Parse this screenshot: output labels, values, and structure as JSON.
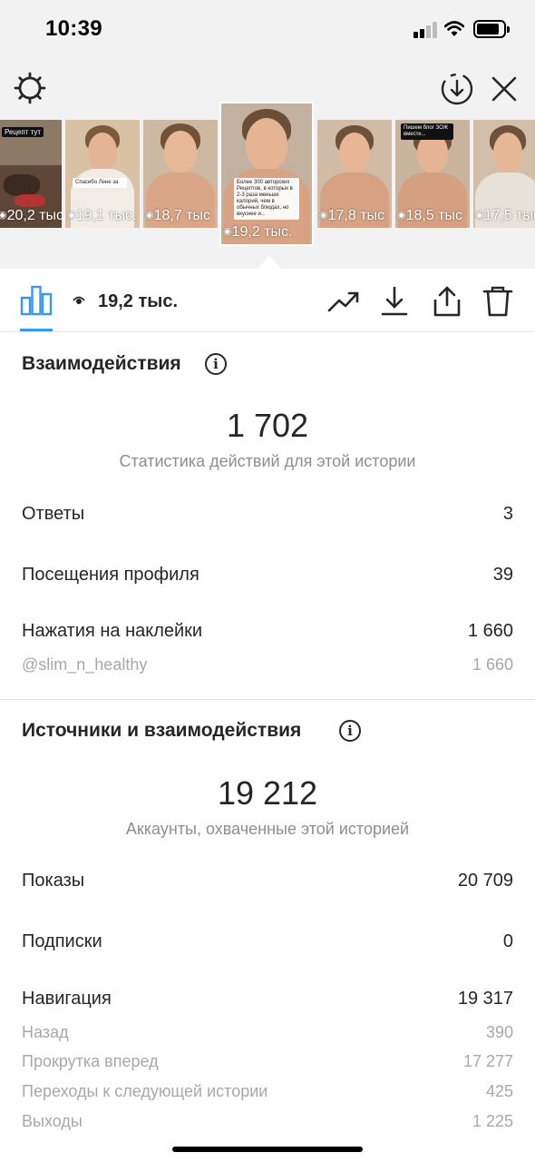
{
  "status_bar": {
    "time": "10:39"
  },
  "thumbnails": [
    {
      "views": "20,2 тыс",
      "tag": "Рецепт тут",
      "active": false
    },
    {
      "views": "19,1 тыс.",
      "tag": "Спасибо Лене за",
      "active": false
    },
    {
      "views": "18,7 тыс",
      "tag": "",
      "active": false
    },
    {
      "views": "19,2 тыс.",
      "tag": "Более 300 авторских Рецептов, в которых в 2-3 раза меньше калорий, чем в обычных блюдах, но вкуснее и...",
      "active": true
    },
    {
      "views": "17,8 тыс",
      "tag": "",
      "active": false
    },
    {
      "views": "18,5 тыс",
      "tag": "Пишем блог ЗОЖ вместе...",
      "active": false
    },
    {
      "views": "17,5 тыс",
      "tag": "",
      "active": false
    }
  ],
  "toolbar": {
    "views": "19,2 тыс."
  },
  "interactions": {
    "title": "Взаимодействия",
    "total": "1 702",
    "subtitle": "Статистика действий для этой истории",
    "rows": [
      {
        "label": "Ответы",
        "value": "3"
      },
      {
        "label": "Посещения профиля",
        "value": "39"
      },
      {
        "label": "Нажатия на наклейки",
        "value": "1 660"
      }
    ],
    "sticker_account": {
      "label": "@slim_n_healthy",
      "value": "1 660"
    }
  },
  "reach": {
    "title": "Источники и взаимодействия",
    "total": "19 212",
    "subtitle": "Аккаунты, охваченные этой историей",
    "rows": [
      {
        "label": "Показы",
        "value": "20 709"
      },
      {
        "label": "Подписки",
        "value": "0"
      }
    ],
    "navigation": {
      "label": "Навигация",
      "value": "19 317",
      "items": [
        {
          "label": "Назад",
          "value": "390"
        },
        {
          "label": "Прокрутка вперед",
          "value": "17 277"
        },
        {
          "label": "Переходы к следующей истории",
          "value": "425"
        },
        {
          "label": "Выходы",
          "value": "1 225"
        }
      ]
    }
  },
  "colors": {
    "accent": "#3897f0",
    "text": "#262626",
    "muted": "#8e8e8e",
    "panel": "#f2f2f2"
  }
}
